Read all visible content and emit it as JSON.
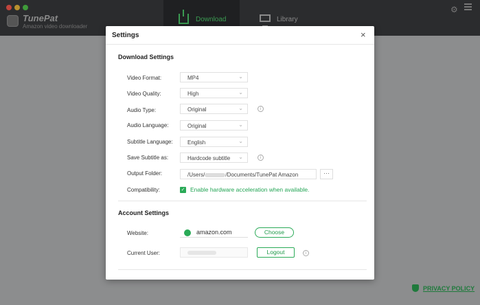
{
  "app": {
    "name": "TunePat",
    "subtitle": "Amazon video downloader",
    "nav_download": "Download",
    "nav_library": "Library"
  },
  "privacy_policy": "PRIVACY POLICY",
  "dialog": {
    "title": "Settings",
    "close_glyph": "×",
    "download_section": "Download Settings",
    "rows": {
      "video_format": {
        "label": "Video Format:",
        "value": "MP4"
      },
      "video_quality": {
        "label": "Video Quality:",
        "value": "High"
      },
      "audio_type": {
        "label": "Audio Type:",
        "value": "Original"
      },
      "audio_language": {
        "label": "Audio Language:",
        "value": "Original"
      },
      "subtitle_language": {
        "label": "Subtitle Language:",
        "value": "English"
      },
      "save_subtitle": {
        "label": "Save Subtitle as:",
        "value": "Hardcode subtitle"
      },
      "output_folder": {
        "label": "Output Folder:",
        "value_prefix": "/Users/",
        "value_suffix": "/Documents/TunePat Amazon",
        "browse": "···"
      },
      "compatibility": {
        "label": "Compatibility:",
        "value": "Enable hardware acceleration when available.",
        "checked": true
      }
    },
    "account_section": "Account Settings",
    "website": {
      "label": "Website:",
      "value": "amazon.com",
      "button": "Choose"
    },
    "current_user": {
      "label": "Current User:",
      "button": "Logout"
    }
  },
  "colors": {
    "accent": "#2aaa57",
    "header": "#2b2c2e"
  }
}
